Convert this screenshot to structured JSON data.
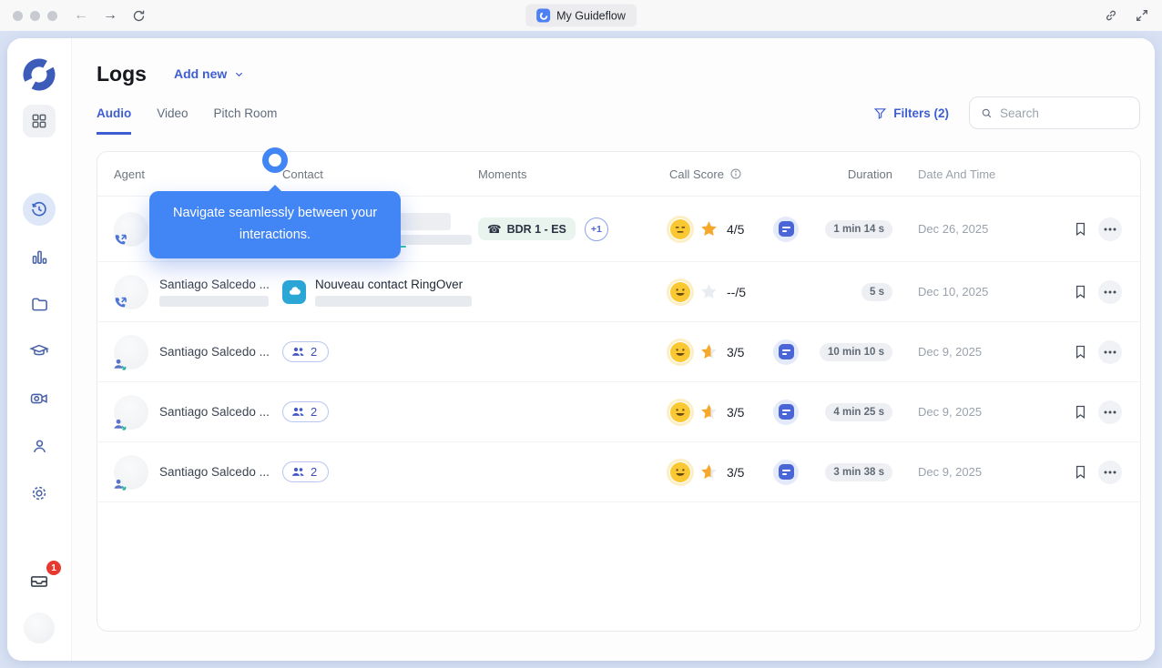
{
  "browser": {
    "tab_title": "My Guideflow"
  },
  "sidebar": {
    "inbox_badge": "1",
    "items": [
      {
        "name": "dashboard"
      },
      {
        "name": "history"
      },
      {
        "name": "analytics"
      },
      {
        "name": "library"
      },
      {
        "name": "academy"
      },
      {
        "name": "recordings"
      },
      {
        "name": "contacts"
      },
      {
        "name": "settings"
      }
    ]
  },
  "page": {
    "title": "Logs",
    "add_new": "Add new"
  },
  "tabs": [
    {
      "label": "Audio"
    },
    {
      "label": "Video"
    },
    {
      "label": "Pitch Room"
    }
  ],
  "toolbar": {
    "filters": "Filters (2)",
    "search_placeholder": "Search"
  },
  "table": {
    "columns": [
      "Agent",
      "Contact",
      "Moments",
      "Call Score",
      "Duration",
      "Date And Time"
    ],
    "rows": [
      {
        "agent": "",
        "contact": "",
        "moments_badge": "BDR 1 - ES",
        "moments_extra": "+1",
        "score": "4/5",
        "duration": "1 min 14 s",
        "date": "Dec 26, 2025"
      },
      {
        "agent": "Santiago Salcedo ...",
        "contact": "Nouveau contact RingOver",
        "score": "--/5",
        "duration": "5 s",
        "date": "Dec 10, 2025"
      },
      {
        "agent": "Santiago Salcedo ...",
        "contact_count": "2",
        "score": "3/5",
        "duration": "10 min 10 s",
        "date": "Dec 9, 2025"
      },
      {
        "agent": "Santiago Salcedo ...",
        "contact_count": "2",
        "score": "3/5",
        "duration": "4 min 25 s",
        "date": "Dec 9, 2025"
      },
      {
        "agent": "Santiago Salcedo ...",
        "contact_count": "2",
        "score": "3/5",
        "duration": "3 min 38 s",
        "date": "Dec 9, 2025"
      }
    ]
  },
  "tooltip": {
    "text": "Navigate seamlessly between your interactions."
  },
  "colors": {
    "accent": "#3d5ed2",
    "tooltip_blue": "#4285f4",
    "star_orange": "#f6a82c",
    "mint_badge_bg": "#e8f4ed",
    "ringover_teal": "#2ba7d6",
    "alert_red": "#e63a30"
  }
}
